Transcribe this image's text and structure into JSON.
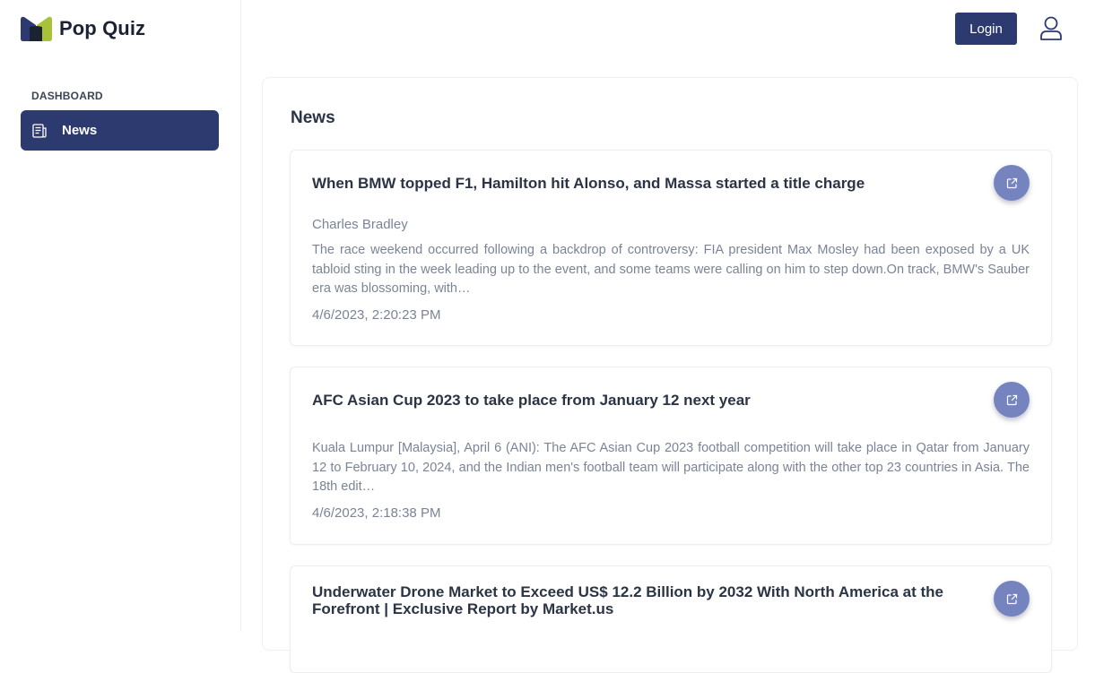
{
  "app": {
    "name": "Pop Quiz"
  },
  "sidebar": {
    "section_label": "DASHBOARD",
    "items": [
      {
        "label": "News",
        "icon": "newspaper-icon",
        "active": true
      }
    ]
  },
  "topbar": {
    "login_label": "Login",
    "user_icon": "user-icon"
  },
  "main": {
    "title": "News",
    "articles": [
      {
        "title": "When BMW topped F1, Hamilton hit Alonso, and Massa started a title charge",
        "author": "Charles Bradley",
        "description": "The race weekend occurred following a backdrop of controversy: FIA president Max Mosley had been exposed by a UK tabloid sting in the week leading up to the event, and some teams were calling on him to step down.On track, BMW's Sauber era was blossoming, with…",
        "date": "4/6/2023, 2:20:23 PM"
      },
      {
        "title": "AFC Asian Cup 2023 to take place from January 12 next year",
        "author": "",
        "description": "Kuala Lumpur [Malaysia], April 6 (ANI): The AFC Asian Cup 2023 football competition will take place in Qatar from January 12 to February 10, 2024, and the Indian men's football team will participate along with the other top 23 countries in Asia. The 18th edit…",
        "date": "4/6/2023, 2:18:38 PM"
      },
      {
        "title": "Underwater Drone Market to Exceed US$ 12.2 Billion by 2032 With North America at the Forefront | Exclusive Report by Market.us"
      }
    ]
  },
  "colors": {
    "primary": "#2c3a70",
    "open_button": "#7584be",
    "muted_text": "#7a8496"
  }
}
